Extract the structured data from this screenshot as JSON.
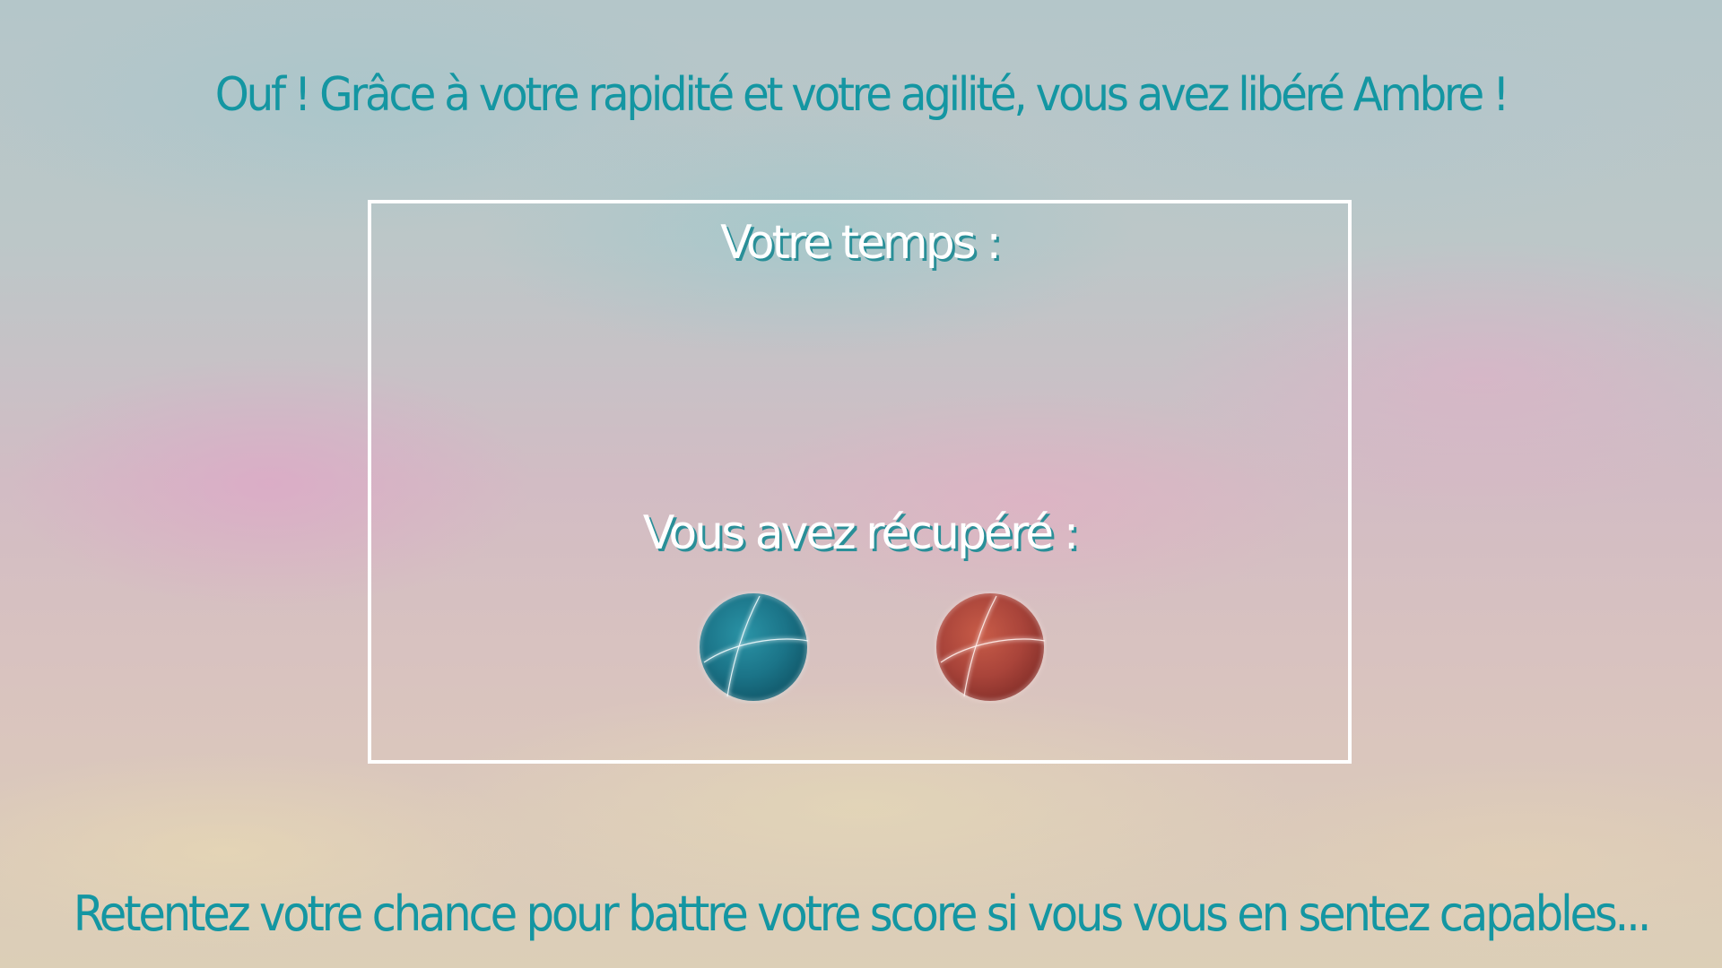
{
  "header": {
    "message": "Ouf ! Grâce à votre rapidité et votre agilité, vous avez libéré Ambre !"
  },
  "results": {
    "time_label": "Votre temps :",
    "time_value": "",
    "recovered_label": "Vous avez récupéré :",
    "collected_items": [
      {
        "icon": "blue-orb-icon",
        "color": "#1f7f92"
      },
      {
        "icon": "red-orb-icon",
        "color": "#b04a3a"
      }
    ]
  },
  "footer": {
    "message": "Retentez votre chance pour battre votre score si vous vous en sentez capables..."
  },
  "colors": {
    "accent_text": "#1496a2",
    "panel_border": "#ffffff",
    "label_shadow": "#2a8f98"
  }
}
